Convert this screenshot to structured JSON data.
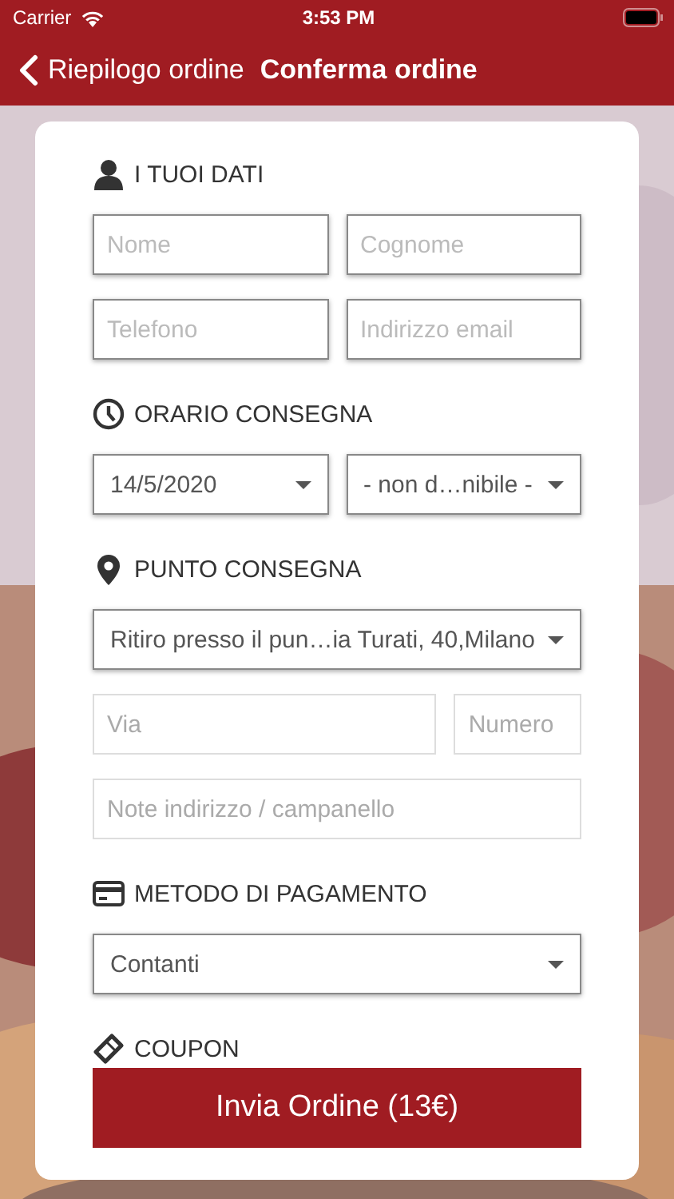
{
  "status_bar": {
    "carrier": "Carrier",
    "time": "3:53 PM"
  },
  "nav": {
    "back_label": "Riepilogo ordine",
    "title": "Conferma ordine"
  },
  "sections": [
    {
      "kind": "person",
      "title": "I TUOI DATI",
      "rows": [
        [
          {
            "kind": "input",
            "placeholder": "Nome",
            "disabled": false
          },
          {
            "kind": "input",
            "placeholder": "Cognome",
            "disabled": false
          }
        ],
        [
          {
            "kind": "input",
            "placeholder": "Telefono",
            "disabled": false
          },
          {
            "kind": "input",
            "placeholder": "Indirizzo email",
            "disabled": false
          }
        ]
      ]
    },
    {
      "kind": "clock",
      "title": "ORARIO CONSEGNA",
      "rows": [
        [
          {
            "kind": "select",
            "value": "14/5/2020"
          },
          {
            "kind": "select",
            "value": "- non d…nibile -"
          }
        ]
      ]
    },
    {
      "kind": "pin",
      "title": "PUNTO CONSEGNA",
      "rows": [
        [
          {
            "kind": "select",
            "value": "Ritiro presso il pun…ia Turati, 40,Milano"
          }
        ],
        [
          {
            "kind": "input",
            "placeholder": "Via",
            "disabled": true,
            "wide": true
          },
          {
            "kind": "input",
            "placeholder": "Numero",
            "disabled": true
          }
        ],
        [
          {
            "kind": "input",
            "placeholder": "Note indirizzo / campanello",
            "disabled": true
          }
        ]
      ]
    },
    {
      "kind": "card",
      "title": "METODO DI PAGAMENTO",
      "rows": [
        [
          {
            "kind": "select",
            "value": "Contanti"
          }
        ]
      ]
    },
    {
      "kind": "ticket",
      "title": "COUPON"
    }
  ],
  "submit_button": {
    "label": "Invia Ordine (13€)"
  }
}
